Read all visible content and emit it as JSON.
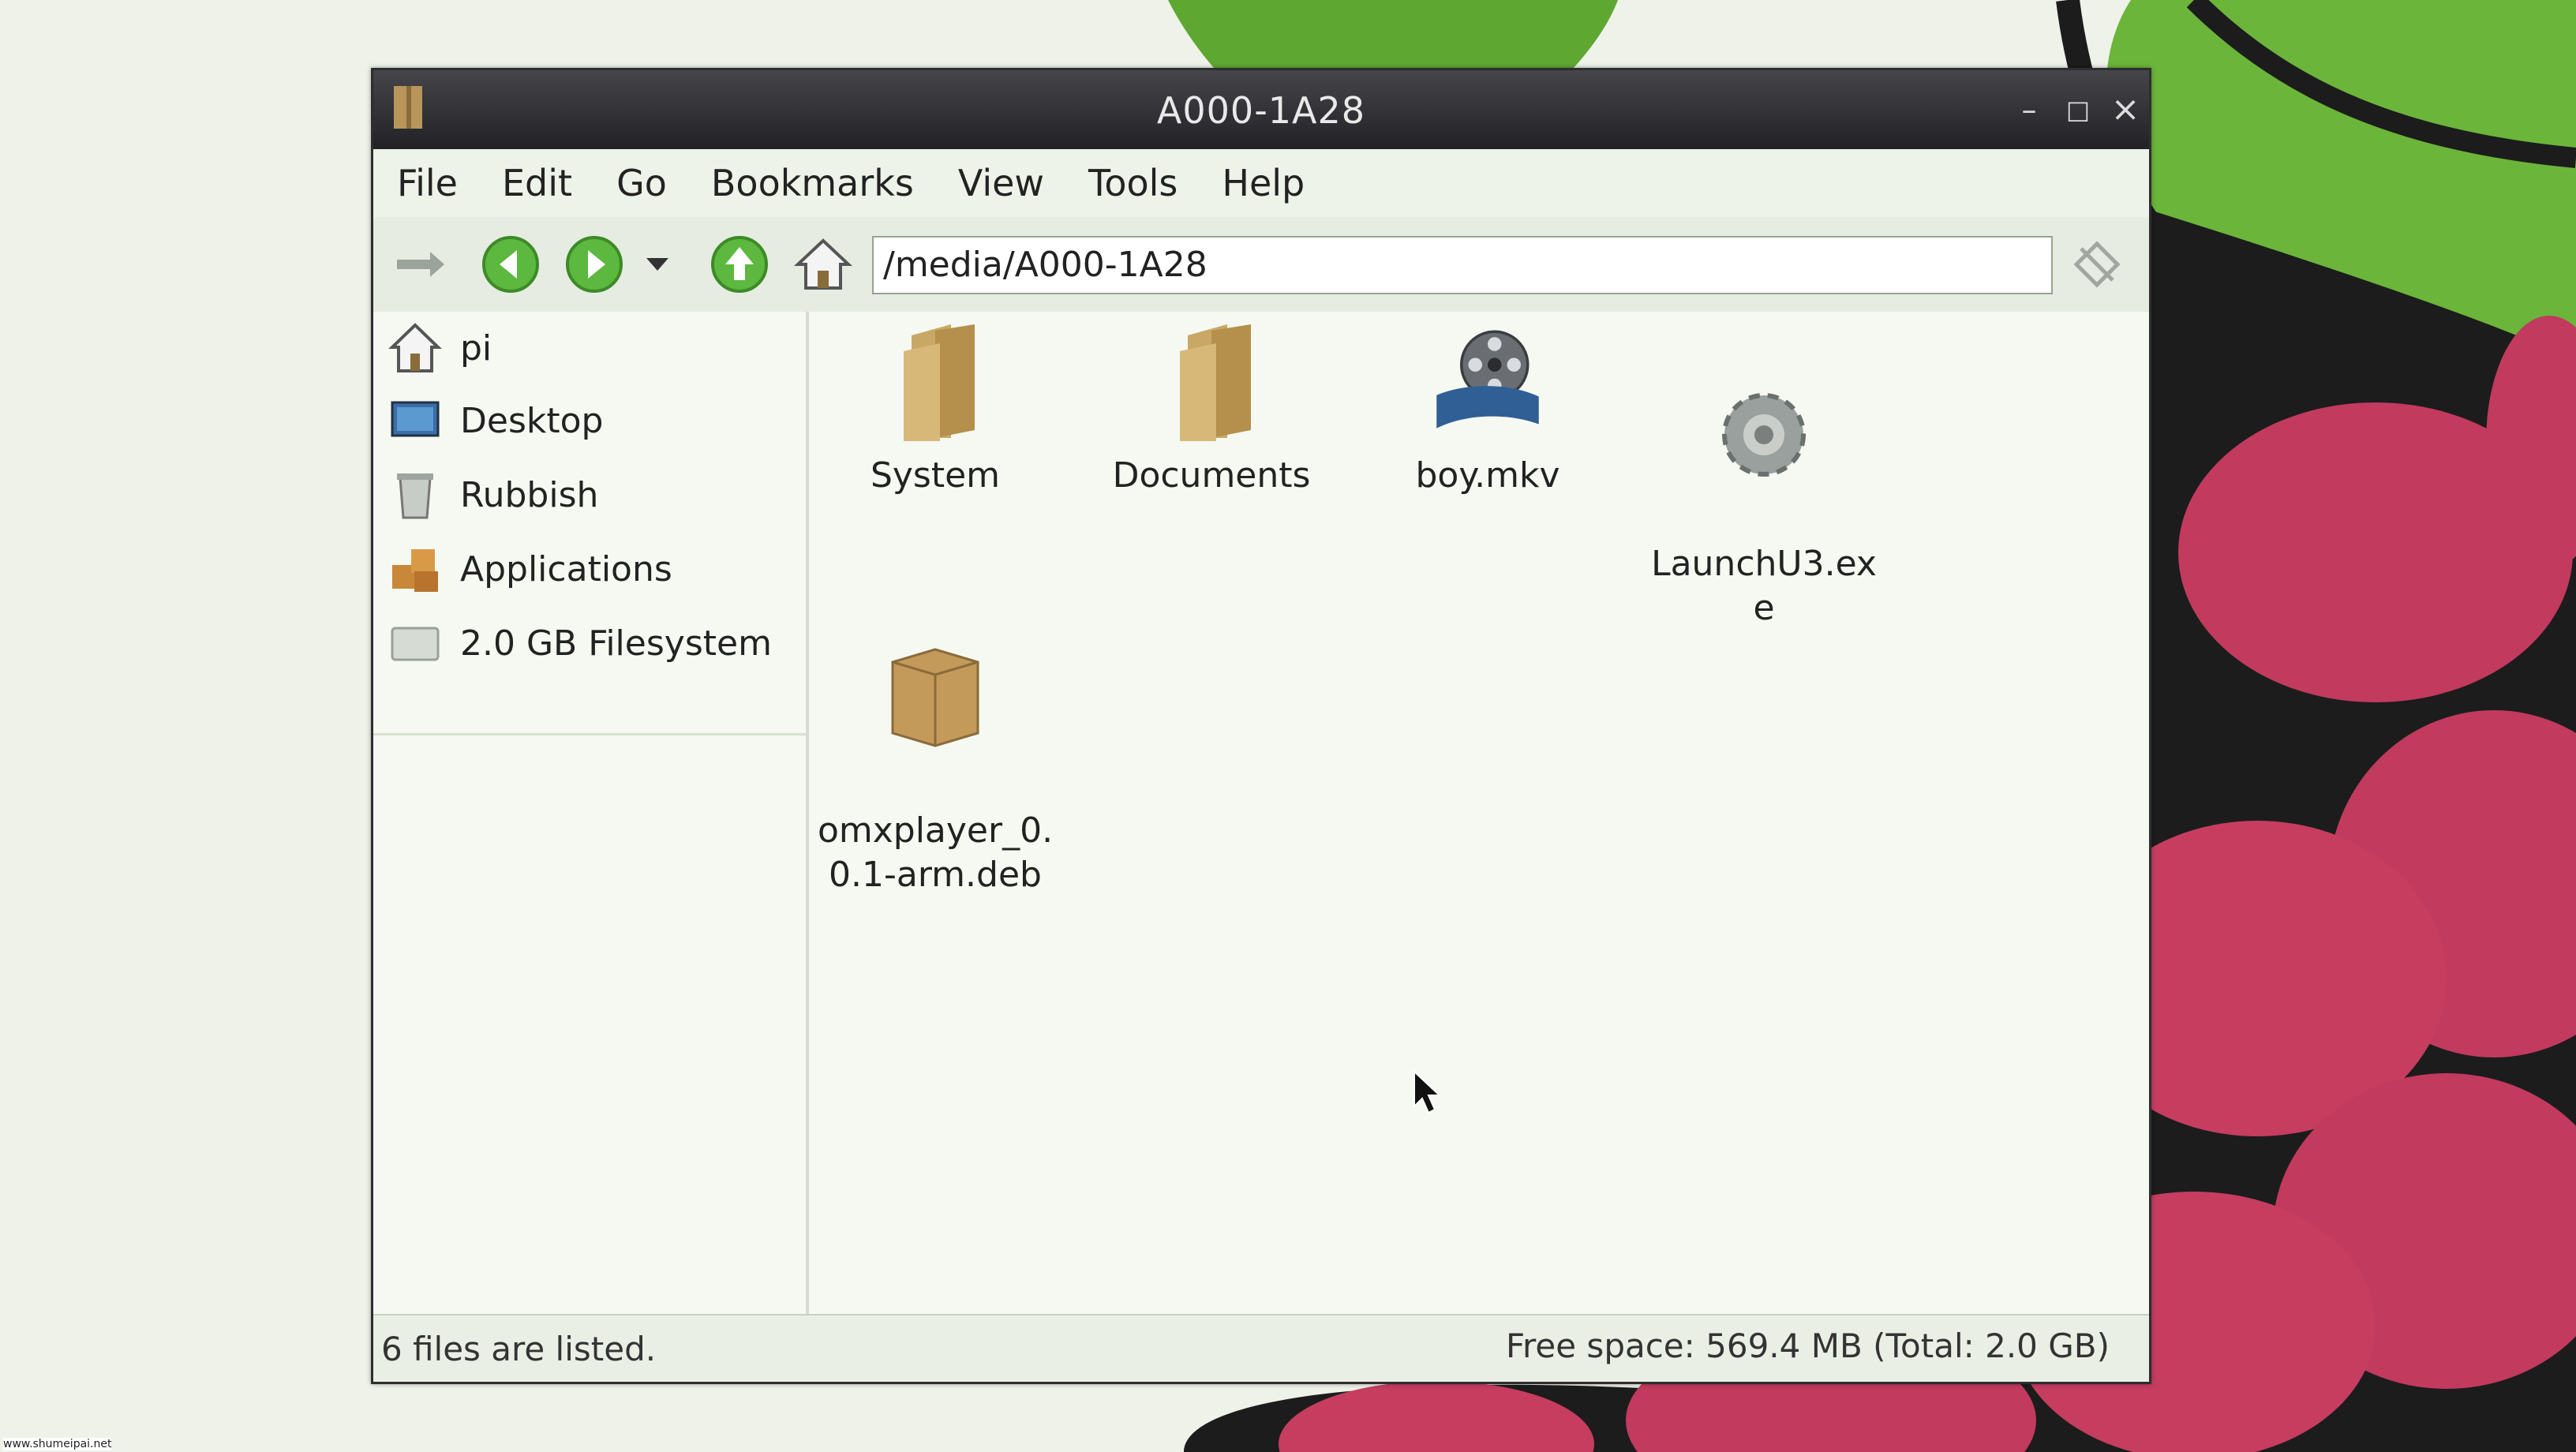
{
  "window": {
    "title": "A000-1A28",
    "controls": {
      "minimize": "–",
      "maximize": "□",
      "close": "×"
    }
  },
  "menubar": {
    "items": [
      "File",
      "Edit",
      "Go",
      "Bookmarks",
      "View",
      "Tools",
      "Help"
    ]
  },
  "toolbar": {
    "address": "/media/A000-1A28"
  },
  "sidebar": {
    "items": [
      {
        "label": "pi",
        "icon": "home-icon"
      },
      {
        "label": "Desktop",
        "icon": "desktop-icon"
      },
      {
        "label": "Rubbish",
        "icon": "trash-icon"
      },
      {
        "label": "Applications",
        "icon": "applications-icon"
      },
      {
        "label": "2.0 GB Filesystem",
        "icon": "drive-icon"
      }
    ]
  },
  "files": [
    {
      "label": "System",
      "icon": "folder-icon"
    },
    {
      "label": "Documents",
      "icon": "folder-icon"
    },
    {
      "label": "boy.mkv",
      "icon": "video-file-icon"
    },
    {
      "label": "LaunchU3.ex\ne",
      "icon": "executable-gear-icon"
    },
    {
      "label": "omxplayer_0.\n0.1-arm.deb",
      "icon": "package-icon"
    }
  ],
  "status": {
    "left": "6 files are listed.",
    "right": "Free space: 569.4 MB (Total: 2.0 GB)"
  },
  "watermark": "www.shumeipai.net",
  "colors": {
    "titlebar": "#2b2b2f",
    "window_bg": "#f3f7ee",
    "raspberry_red": "#c23a5e",
    "leaf_green": "#6bb53a"
  }
}
